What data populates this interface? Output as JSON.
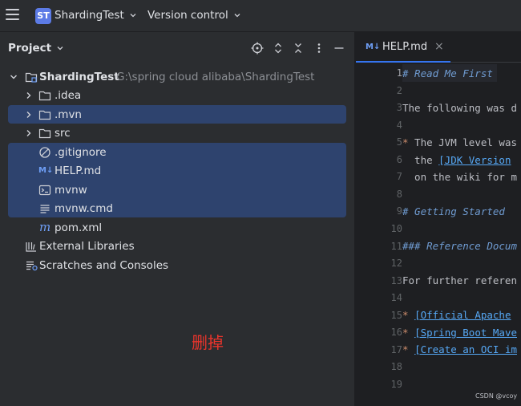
{
  "titlebar": {
    "project_badge": "ST",
    "project_name": "ShardingTest",
    "vcs_label": "Version control"
  },
  "project_panel": {
    "title": "Project",
    "root": {
      "name": "ShardingTest",
      "path": "G:\\spring cloud alibaba\\ShardingTest"
    },
    "items": [
      {
        "name": ".idea"
      },
      {
        "name": ".mvn"
      },
      {
        "name": "src"
      },
      {
        "name": ".gitignore"
      },
      {
        "name": "HELP.md"
      },
      {
        "name": "mvnw"
      },
      {
        "name": "mvnw.cmd"
      },
      {
        "name": "pom.xml"
      },
      {
        "name": "External Libraries"
      },
      {
        "name": "Scratches and Consoles"
      }
    ],
    "annotation": "删掉"
  },
  "editor": {
    "tab": {
      "badge": "M↓",
      "label": "HELP.md",
      "close": "×"
    },
    "line_numbers": [
      "1",
      "2",
      "3",
      "4",
      "5",
      "6",
      "7",
      "8",
      "9",
      "10",
      "11",
      "12",
      "13",
      "14",
      "15",
      "16",
      "17",
      "18",
      "19"
    ],
    "lines": {
      "l1": "# Read Me First",
      "l3": "The following was d",
      "l5_bullet": "*",
      "l5": " The JVM level was",
      "l6_pre": "  the ",
      "l6_link": "[JDK Version",
      "l7": "  on the wiki for m",
      "l9": "# Getting Started",
      "l11": "### Reference Docum",
      "l13": "For further referen",
      "l15_bullet": "*",
      "l15_link": "[Official Apache",
      "l16_bullet": "*",
      "l16_link": "[Spring Boot Mave",
      "l17_bullet": "*",
      "l17_link": "[Create an OCI im"
    }
  },
  "watermark": "CSDN @vcoy",
  "colors": {
    "accent": "#3574f0",
    "selection": "#2e436e",
    "annotation": "#e8342c"
  }
}
